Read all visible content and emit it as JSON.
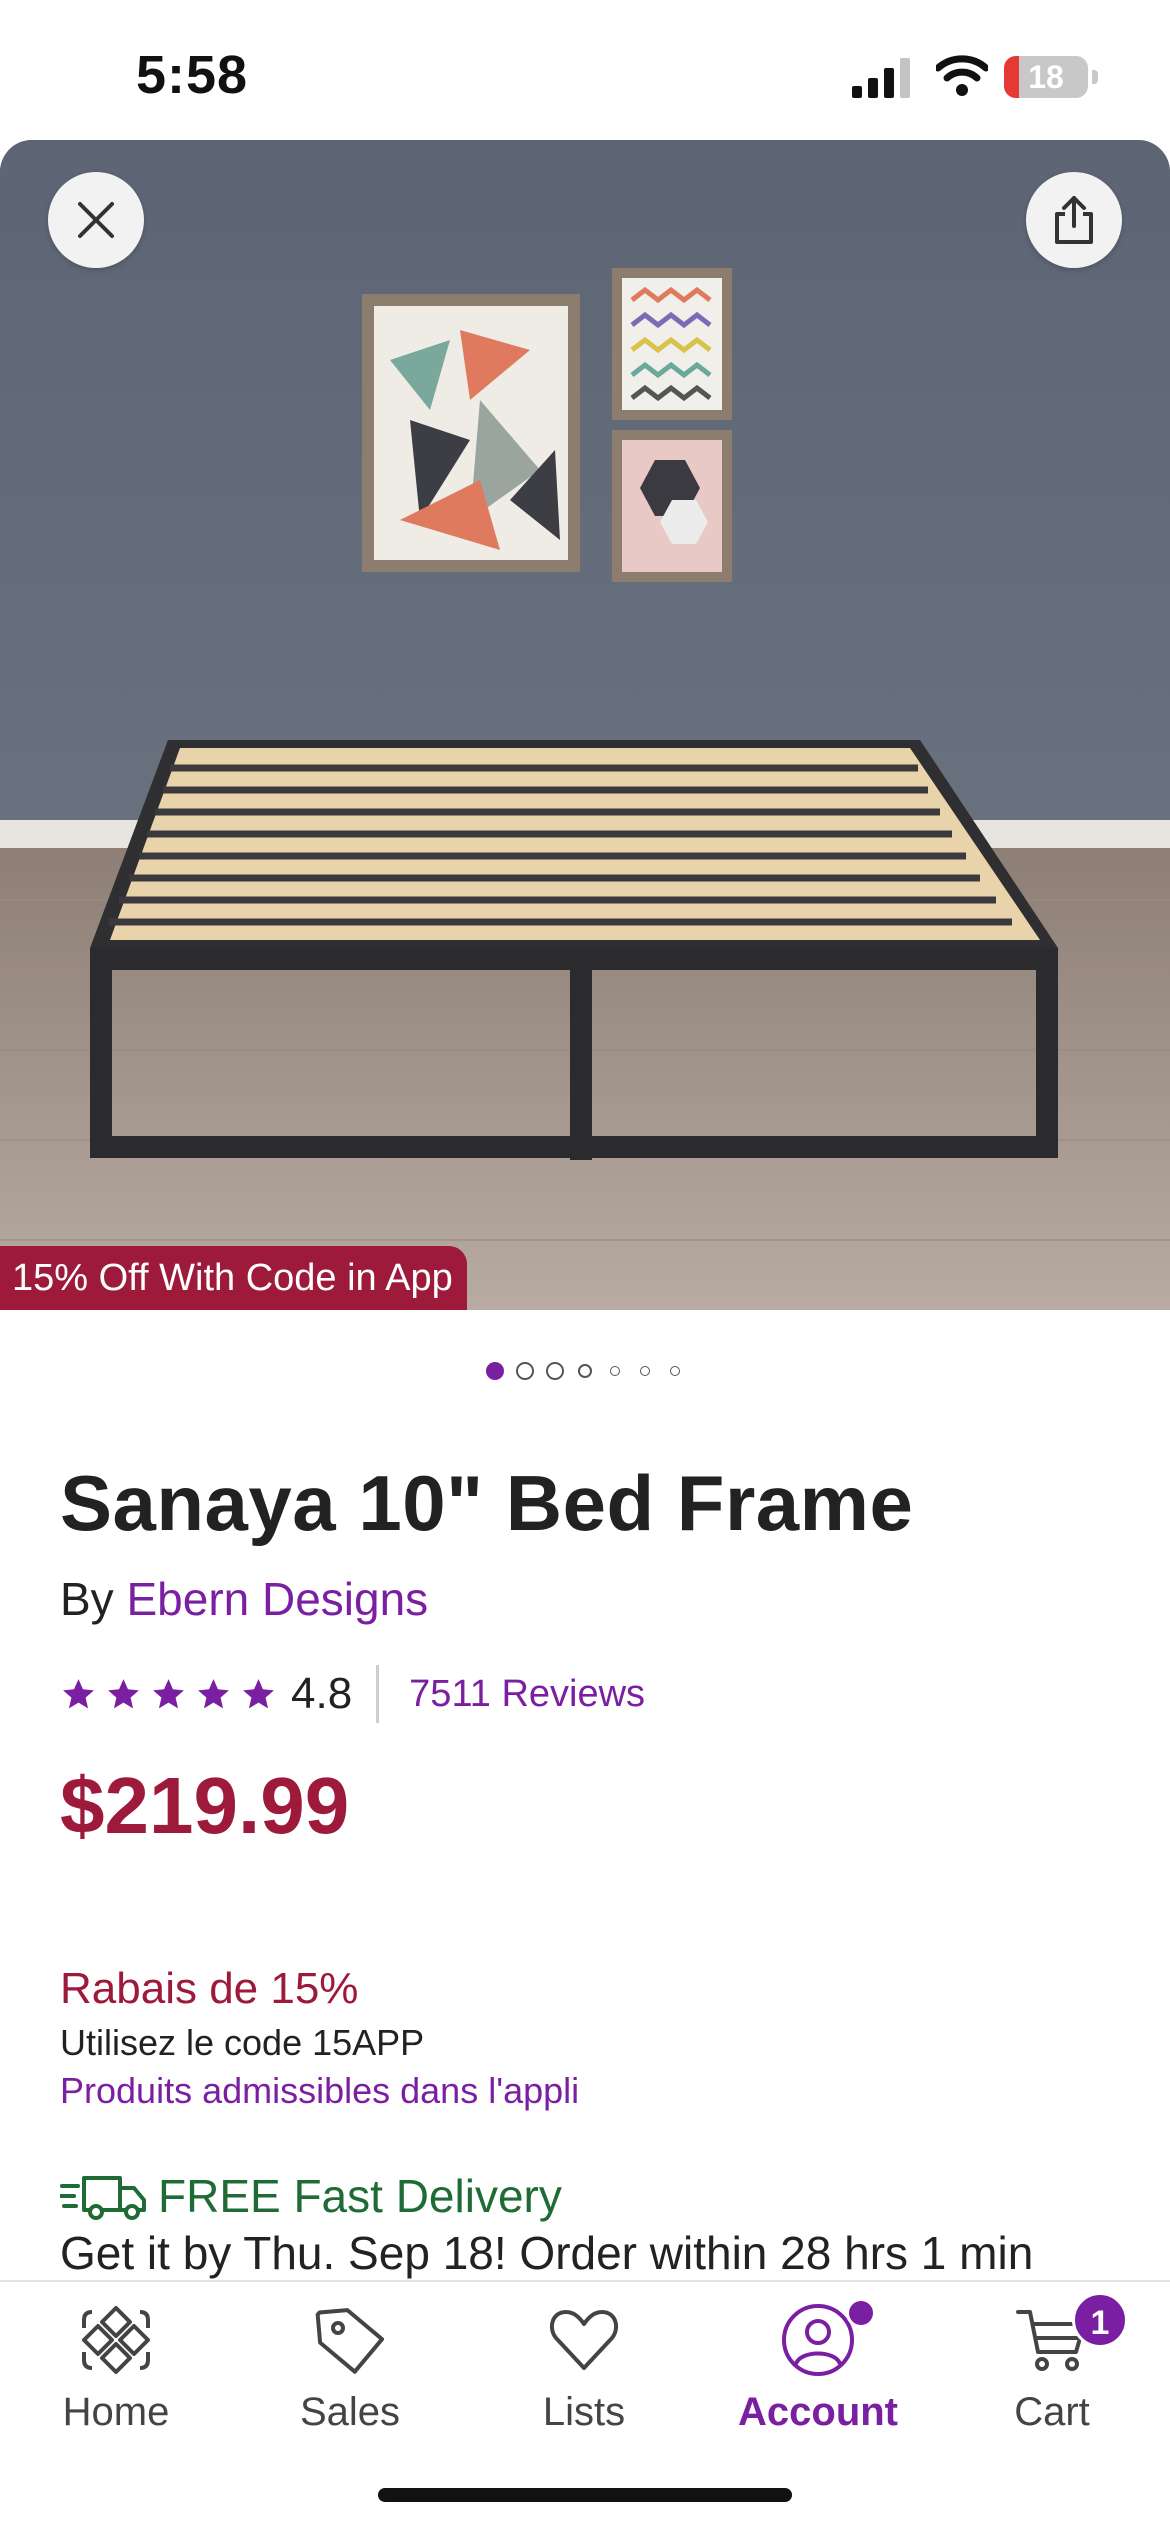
{
  "status_bar": {
    "time": "5:58",
    "battery_level": "18",
    "battery_fraction": 0.18,
    "signal_icon": "cellular-signal-icon",
    "wifi_icon": "wifi-icon"
  },
  "hero": {
    "promo_badge": "15% Off With Code in App",
    "close_icon": "close-icon",
    "share_icon": "share-icon",
    "image_count": 7,
    "active_image_index": 0
  },
  "product": {
    "title": "Sanaya 10\" Bed Frame",
    "by_prefix": "By",
    "brand": "Ebern Designs",
    "rating": "4.8",
    "rating_value": 4.8,
    "rating_max": 5,
    "reviews": "7511 Reviews",
    "price": "$219.99"
  },
  "discount": {
    "title": "Rabais de 15%",
    "code_text": "Utilisez le code 15APP",
    "eligible_text": "Produits admissibles dans l'appli"
  },
  "delivery": {
    "title": "FREE Fast Delivery",
    "eta": "Get it by Thu. Sep 18! Order within 28 hrs 1 min"
  },
  "bottom_nav": {
    "items": [
      {
        "label": "Home",
        "icon": "home-icon"
      },
      {
        "label": "Sales",
        "icon": "tag-icon"
      },
      {
        "label": "Lists",
        "icon": "heart-icon"
      },
      {
        "label": "Account",
        "icon": "account-icon",
        "active": true
      },
      {
        "label": "Cart",
        "icon": "cart-icon"
      }
    ],
    "cart_count": "1"
  },
  "colors": {
    "brand_purple": "#7b1fa2",
    "price_red": "#9e1a3b",
    "delivery_green": "#1f6b35"
  }
}
